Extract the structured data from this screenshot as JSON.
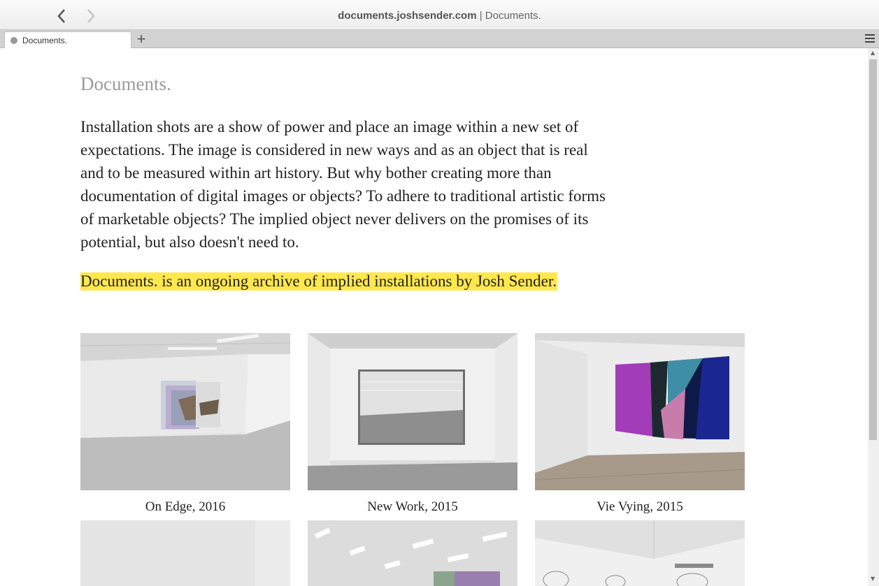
{
  "browser": {
    "url_domain": "documents.joshsender.com",
    "url_rest": " | Documents.",
    "tab_label": "Documents.",
    "new_tab_symbol": "+"
  },
  "page": {
    "title": "Documents.",
    "intro": "Installation shots are a show of power and place an image within a new set of expectations. The image is considered in new ways and as an object that is real and to be measured within art history. But why bother creating more than documentation of digital images or objects? To adhere to traditional artistic forms of marketable objects? The implied object never delivers on the promises of its potential, but also doesn't need to.",
    "highlight": "Documents. is an ongoing archive of implied installations by Josh Sender.",
    "highlight_color": "#ffe84d"
  },
  "gallery": [
    {
      "caption": "On Edge, 2016"
    },
    {
      "caption": "New Work, 2015"
    },
    {
      "caption": "Vie Vying, 2015"
    },
    {
      "caption": ""
    },
    {
      "caption": ""
    },
    {
      "caption": ""
    }
  ],
  "icons": [
    "back-arrow-icon",
    "forward-arrow-icon",
    "tab-favicon-icon",
    "plus-icon",
    "hamburger-menu-icon"
  ]
}
